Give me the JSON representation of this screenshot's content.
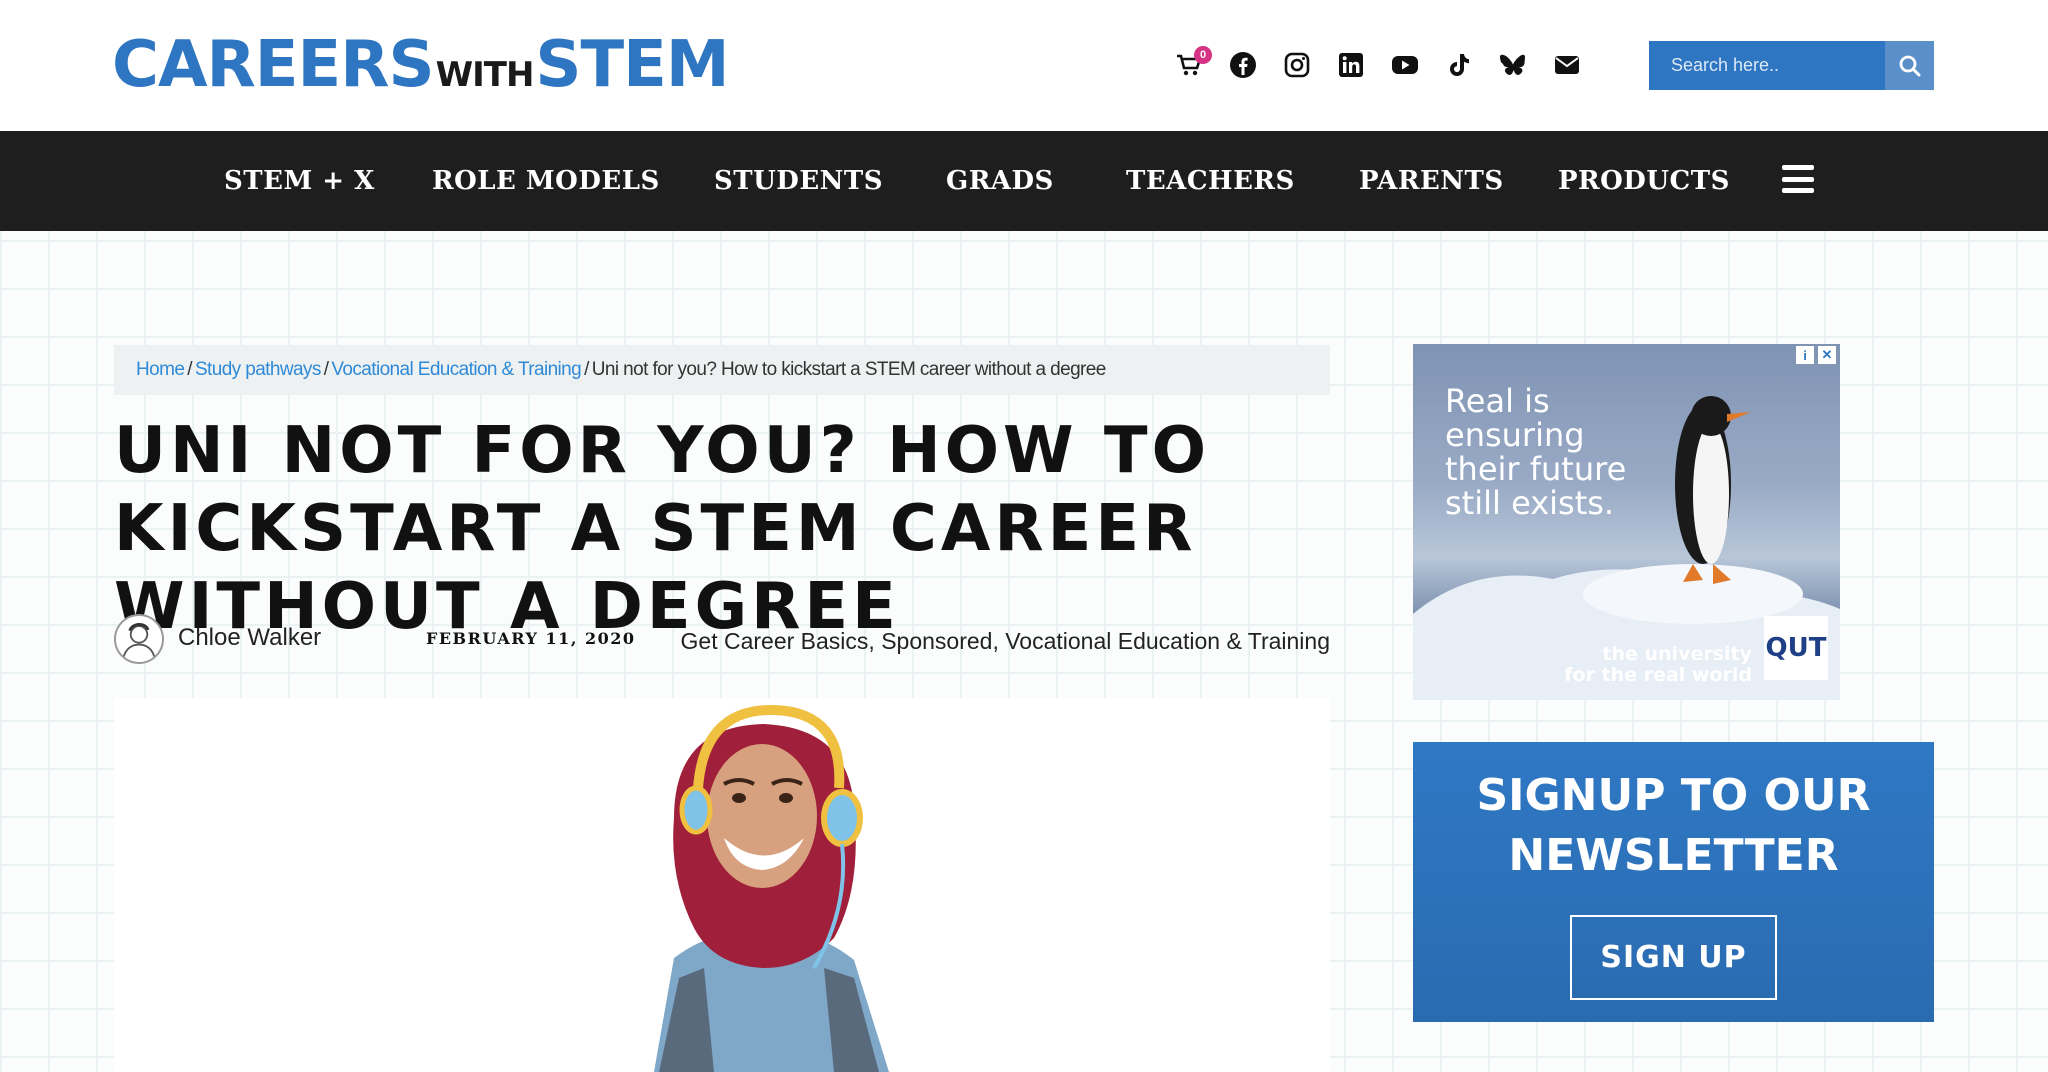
{
  "header": {
    "logo": {
      "part1": "CAREERS",
      "part2": "WITH",
      "part3": "STEM"
    },
    "cart_count": "0",
    "social_icons": [
      "cart-icon",
      "facebook-icon",
      "instagram-icon",
      "linkedin-icon",
      "youtube-icon",
      "tiktok-icon",
      "bluesky-icon",
      "email-icon"
    ],
    "search": {
      "placeholder": "Search here.."
    }
  },
  "nav": {
    "items": [
      "STEM + X",
      "ROLE MODELS",
      "STUDENTS",
      "GRADS",
      "TEACHERS",
      "PARENTS",
      "PRODUCTS"
    ]
  },
  "breadcrumb": {
    "items": [
      "Home",
      "Study pathways",
      "Vocational Education & Training"
    ],
    "separator": "/",
    "current": "Uni not for you? How to kickstart a STEM career without a degree"
  },
  "article": {
    "title": "Uni not for you? How to kickstart a STEM career without a degree",
    "author": "Chloe Walker",
    "date": "February 11, 2020",
    "categories": "Get Career Basics, Sponsored, Vocational Education & Training"
  },
  "ad": {
    "line1": "Real is",
    "line2": "ensuring",
    "line3": "their future",
    "line4": "still exists.",
    "foot1": "the university",
    "foot2": "for the real world",
    "brand": "QUT"
  },
  "newsletter": {
    "title_line1": "Signup to our",
    "title_line2": "newsletter",
    "button": "SIGN UP"
  },
  "colors": {
    "brand_blue": "#2e75c2",
    "nav_bg": "#1e1e1e",
    "link_blue": "#2e8ad8",
    "badge_pink": "#d63384"
  }
}
